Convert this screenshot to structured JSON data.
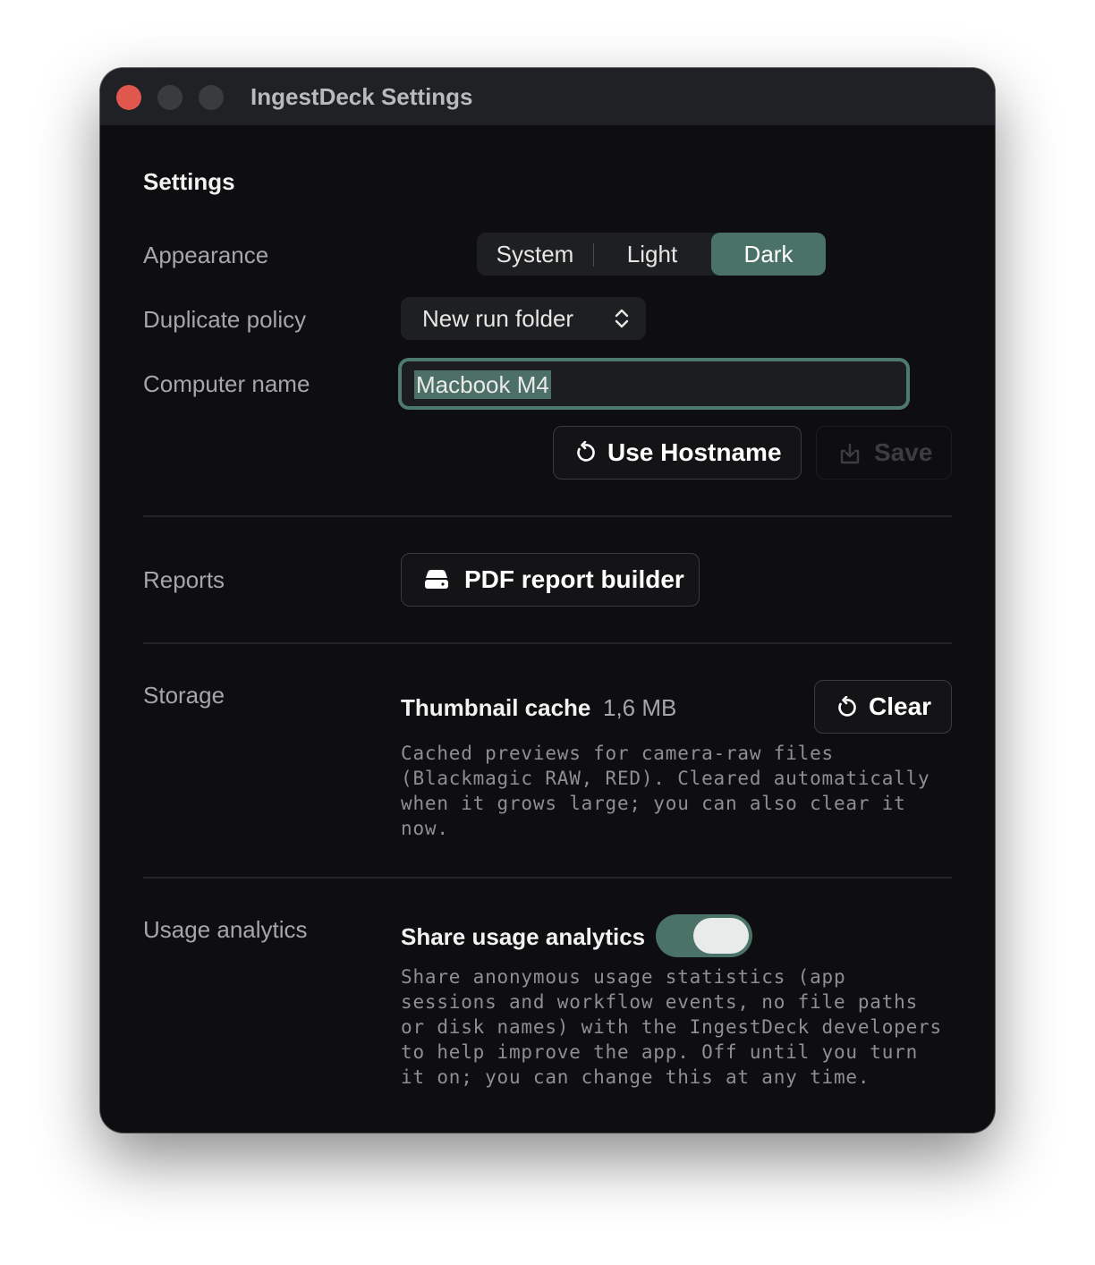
{
  "window": {
    "title": "IngestDeck Settings"
  },
  "settings": {
    "heading": "Settings",
    "appearance": {
      "label": "Appearance",
      "options": [
        "System",
        "Light",
        "Dark"
      ],
      "selected": "Dark"
    },
    "duplicate_policy": {
      "label": "Duplicate policy",
      "value": "New run folder",
      "icon": "chevron-up-down-icon"
    },
    "computer_name": {
      "label": "Computer name",
      "value": "Macbook M4",
      "use_hostname_label": "Use Hostname",
      "use_hostname_icon": "reset-icon",
      "save_label": "Save",
      "save_icon": "save-icon",
      "save_enabled": false
    },
    "reports": {
      "label": "Reports",
      "button_label": "PDF report builder",
      "button_icon": "drive-icon"
    },
    "storage": {
      "label": "Storage",
      "cache_title": "Thumbnail cache",
      "cache_size": "1,6 MB",
      "clear_label": "Clear",
      "clear_icon": "reset-icon",
      "description_lines": [
        "Cached previews for camera-raw files",
        "(Blackmagic RAW, RED). Cleared automatically",
        "when it grows large; you can also clear it",
        "now."
      ]
    },
    "usage_analytics": {
      "label": "Usage analytics",
      "toggle_label": "Share usage analytics",
      "toggle_on": true,
      "description_lines": [
        "Share anonymous usage statistics (app",
        "sessions and workflow events, no file paths",
        "or disk names) with the IngestDeck developers",
        "to help improve the app. Off until you turn",
        "it on; you can change this at any time."
      ]
    }
  },
  "colors": {
    "accent": "#4a7266",
    "window_background": "#0e0e10",
    "titlebar": "#202124",
    "close_button": "#e0584d"
  }
}
